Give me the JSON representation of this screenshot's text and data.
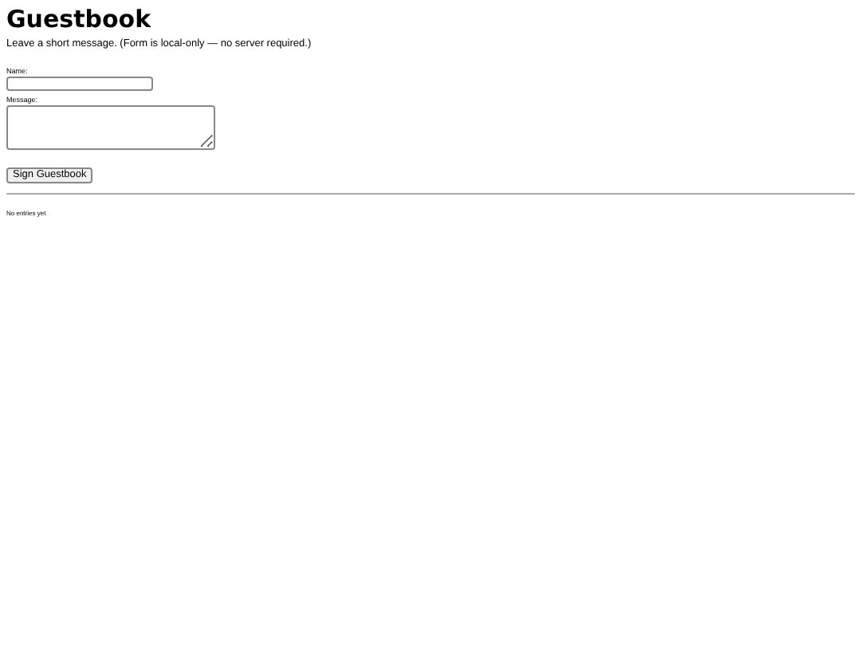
{
  "title": "Guestbook",
  "intro": "Leave a short message. (Form is local-only — no server required.)",
  "fields": [
    {
      "kind": "input",
      "label": "Name:"
    },
    {
      "kind": "textarea",
      "label": "Message:"
    }
  ],
  "submit": "Sign Guestbook",
  "entries_note": "No entries yet"
}
